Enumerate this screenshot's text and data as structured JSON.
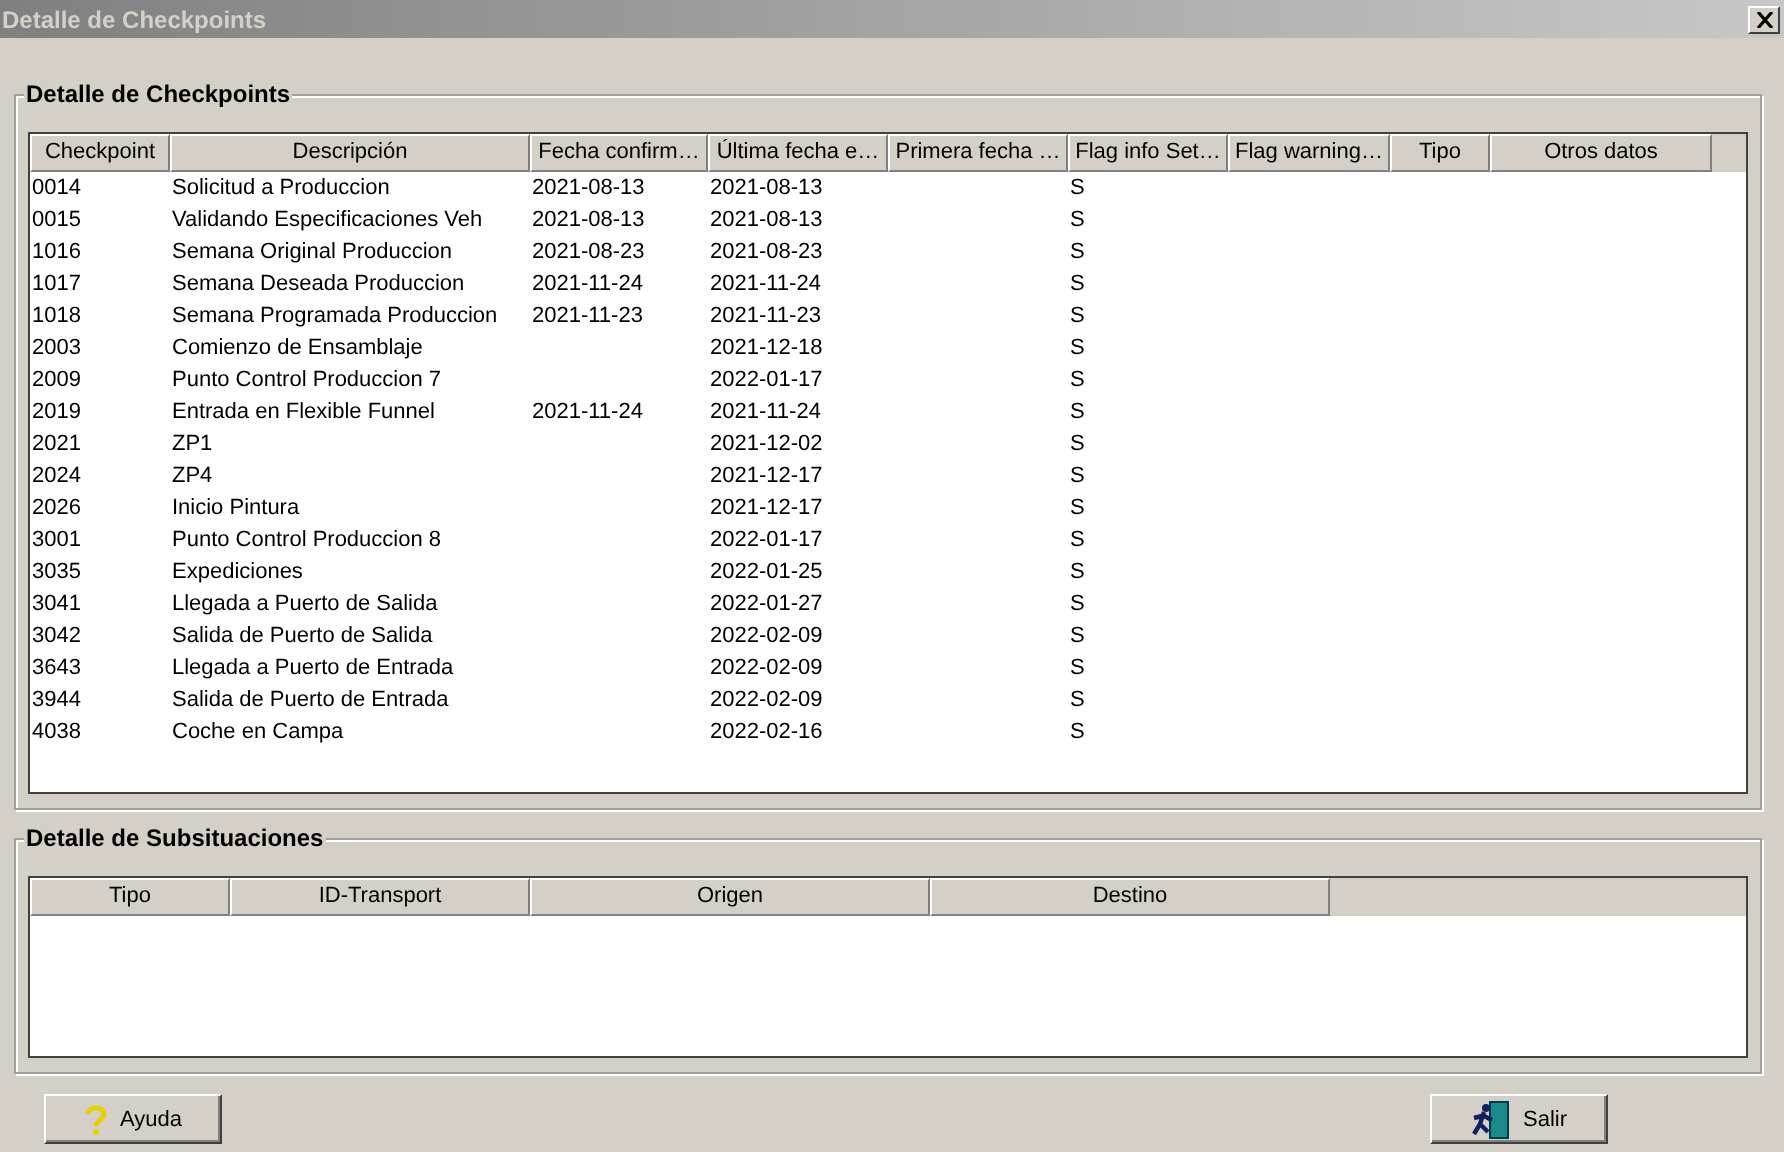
{
  "window": {
    "title": "Detalle de Checkpoints"
  },
  "checkpoints": {
    "title": "Detalle de Checkpoints",
    "columns": [
      "Checkpoint",
      "Descripción",
      "Fecha confirm…",
      "Última fecha e…",
      "Primera fecha …",
      "Flag info Set…",
      "Flag warning…",
      "Tipo",
      "Otros datos"
    ],
    "rows": [
      {
        "checkpoint": "0014",
        "descripcion": "Solicitud a Produccion",
        "fecha_confirmacion": "2021-08-13",
        "ultima_fecha": "2021-08-13",
        "flag_info": "S"
      },
      {
        "checkpoint": "0015",
        "descripcion": "Validando Especificaciones Veh",
        "fecha_confirmacion": "2021-08-13",
        "ultima_fecha": "2021-08-13",
        "flag_info": "S"
      },
      {
        "checkpoint": "1016",
        "descripcion": "Semana Original Produccion",
        "fecha_confirmacion": "2021-08-23",
        "ultima_fecha": "2021-08-23",
        "flag_info": "S"
      },
      {
        "checkpoint": "1017",
        "descripcion": "Semana Deseada Produccion",
        "fecha_confirmacion": "2021-11-24",
        "ultima_fecha": "2021-11-24",
        "flag_info": "S"
      },
      {
        "checkpoint": "1018",
        "descripcion": "Semana Programada Produccion",
        "fecha_confirmacion": "2021-11-23",
        "ultima_fecha": "2021-11-23",
        "flag_info": "S"
      },
      {
        "checkpoint": "2003",
        "descripcion": "Comienzo de Ensamblaje",
        "ultima_fecha": "2021-12-18",
        "flag_info": "S"
      },
      {
        "checkpoint": "2009",
        "descripcion": "Punto Control Produccion 7",
        "ultima_fecha": "2022-01-17",
        "flag_info": "S"
      },
      {
        "checkpoint": "2019",
        "descripcion": "Entrada en Flexible Funnel",
        "fecha_confirmacion": "2021-11-24",
        "ultima_fecha": "2021-11-24",
        "flag_info": "S"
      },
      {
        "checkpoint": "2021",
        "descripcion": "ZP1",
        "ultima_fecha": "2021-12-02",
        "flag_info": "S"
      },
      {
        "checkpoint": "2024",
        "descripcion": "ZP4",
        "ultima_fecha": "2021-12-17",
        "flag_info": "S"
      },
      {
        "checkpoint": "2026",
        "descripcion": "Inicio Pintura",
        "ultima_fecha": "2021-12-17",
        "flag_info": "S"
      },
      {
        "checkpoint": "3001",
        "descripcion": "Punto Control Produccion 8",
        "ultima_fecha": "2022-01-17",
        "flag_info": "S"
      },
      {
        "checkpoint": "3035",
        "descripcion": "Expediciones",
        "ultima_fecha": "2022-01-25",
        "flag_info": "S"
      },
      {
        "checkpoint": "3041",
        "descripcion": "Llegada a Puerto de Salida",
        "ultima_fecha": "2022-01-27",
        "flag_info": "S"
      },
      {
        "checkpoint": "3042",
        "descripcion": "Salida de Puerto de Salida",
        "ultima_fecha": "2022-02-09",
        "flag_info": "S"
      },
      {
        "checkpoint": "3643",
        "descripcion": "Llegada a Puerto de Entrada",
        "ultima_fecha": "2022-02-09",
        "flag_info": "S"
      },
      {
        "checkpoint": "3944",
        "descripcion": "Salida de Puerto de Entrada",
        "ultima_fecha": "2022-02-09",
        "flag_info": "S"
      },
      {
        "checkpoint": "4038",
        "descripcion": "Coche en Campa",
        "ultima_fecha": "2022-02-16",
        "flag_info": "S"
      }
    ]
  },
  "subsituaciones": {
    "title": "Detalle de Subsituaciones",
    "columns": [
      "Tipo",
      "ID-Transport",
      "Origen",
      "Destino"
    ]
  },
  "buttons": [
    {
      "kind": "help",
      "label": "Ayuda"
    },
    {
      "kind": "exit",
      "label": "Salir"
    }
  ]
}
